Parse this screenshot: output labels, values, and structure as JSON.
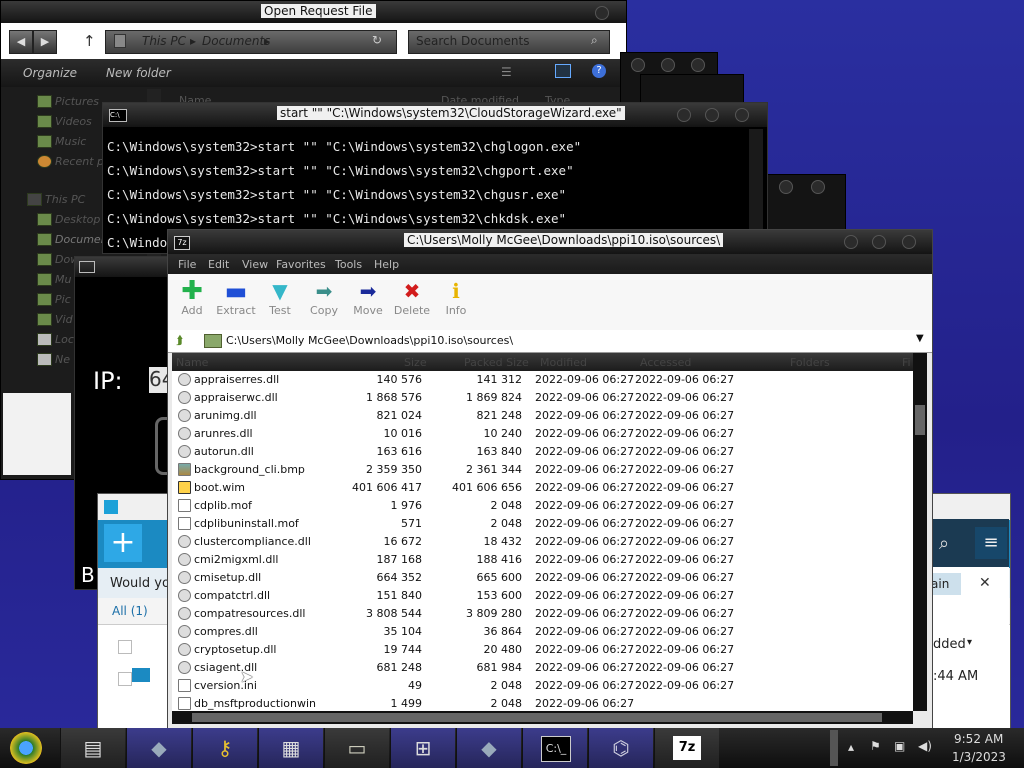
{
  "explorer": {
    "title": "Open Request File",
    "breadcrumb": [
      "This PC",
      "Documents"
    ],
    "search_placeholder": "Search Documents",
    "organize": "Organize",
    "new_folder": "New folder",
    "nav": [
      "Pictures",
      "Videos",
      "Music",
      "Recent pl",
      "This PC",
      "Desktop",
      "Documen",
      "Dow",
      "Mu",
      "Pic",
      "Vid",
      "Loc",
      "Ne"
    ],
    "col_name": "Name",
    "col_date": "Date modified",
    "col_type": "Type"
  },
  "cmd": {
    "title": "start \"\" \"C:\\Windows\\system32\\CloudStorageWizard.exe\"",
    "lines": [
      "C:\\Windows\\system32>start \"\" \"C:\\Windows\\system32\\chglogon.exe\"",
      "C:\\Windows\\system32>start \"\" \"C:\\Windows\\system32\\chgport.exe\"",
      "C:\\Windows\\system32>start \"\" \"C:\\Windows\\system32\\chgusr.exe\"",
      "C:\\Windows\\system32>start \"\" \"C:\\Windows\\system32\\chkdsk.exe\"",
      "C:\\Windo"
    ]
  },
  "ipwin": {
    "label": "IP:",
    "value": "64",
    "b_text": "B"
  },
  "backup": {
    "prompt": "Would yo",
    "tab_all": "All (1)",
    "action": "ain",
    "col_added": "dded",
    "time": ":44 AM"
  },
  "zip": {
    "title": "C:\\Users\\Molly McGee\\Downloads\\ppi10.iso\\sources\\",
    "menu": [
      "File",
      "Edit",
      "View",
      "Favorites",
      "Tools",
      "Help"
    ],
    "tools": [
      {
        "label": "Add",
        "icon": "plus-icon",
        "color": "#22b14c"
      },
      {
        "label": "Extract",
        "icon": "minus-icon",
        "color": "#1f4fd6"
      },
      {
        "label": "Test",
        "icon": "check-icon",
        "color": "#35b7c9"
      },
      {
        "label": "Copy",
        "icon": "arrow-right-icon",
        "color": "#3a8e8a"
      },
      {
        "label": "Move",
        "icon": "arrow-right-icon",
        "color": "#1a2a9a"
      },
      {
        "label": "Delete",
        "icon": "x-icon",
        "color": "#d21c1c"
      },
      {
        "label": "Info",
        "icon": "info-icon",
        "color": "#e8b400"
      }
    ],
    "path": "C:\\Users\\Molly McGee\\Downloads\\ppi10.iso\\sources\\",
    "columns": [
      "Name",
      "Size",
      "Packed Size",
      "Modified",
      "Accessed",
      "Folders",
      "Fi"
    ],
    "files": [
      {
        "name": "appraiserres.dll",
        "size": "140 576",
        "packed": "141 312",
        "modified": "2022-09-06 06:27",
        "accessed": "2022-09-06 06:27",
        "icon": "gear"
      },
      {
        "name": "appraiserwc.dll",
        "size": "1 868 576",
        "packed": "1 869 824",
        "modified": "2022-09-06 06:27",
        "accessed": "2022-09-06 06:27",
        "icon": "gear"
      },
      {
        "name": "arunimg.dll",
        "size": "821 024",
        "packed": "821 248",
        "modified": "2022-09-06 06:27",
        "accessed": "2022-09-06 06:27",
        "icon": "gear"
      },
      {
        "name": "arunres.dll",
        "size": "10 016",
        "packed": "10 240",
        "modified": "2022-09-06 06:27",
        "accessed": "2022-09-06 06:27",
        "icon": "gear"
      },
      {
        "name": "autorun.dll",
        "size": "163 616",
        "packed": "163 840",
        "modified": "2022-09-06 06:27",
        "accessed": "2022-09-06 06:27",
        "icon": "gear"
      },
      {
        "name": "background_cli.bmp",
        "size": "2 359 350",
        "packed": "2 361 344",
        "modified": "2022-09-06 06:27",
        "accessed": "2022-09-06 06:27",
        "icon": "img"
      },
      {
        "name": "boot.wim",
        "size": "401 606 417",
        "packed": "401 606 656",
        "modified": "2022-09-06 06:27",
        "accessed": "2022-09-06 06:27",
        "icon": "wim"
      },
      {
        "name": "cdplib.mof",
        "size": "1 976",
        "packed": "2 048",
        "modified": "2022-09-06 06:27",
        "accessed": "2022-09-06 06:27",
        "icon": "doc"
      },
      {
        "name": "cdplibuninstall.mof",
        "size": "571",
        "packed": "2 048",
        "modified": "2022-09-06 06:27",
        "accessed": "2022-09-06 06:27",
        "icon": "doc"
      },
      {
        "name": "clustercompliance.dll",
        "size": "16 672",
        "packed": "18 432",
        "modified": "2022-09-06 06:27",
        "accessed": "2022-09-06 06:27",
        "icon": "gear"
      },
      {
        "name": "cmi2migxml.dll",
        "size": "187 168",
        "packed": "188 416",
        "modified": "2022-09-06 06:27",
        "accessed": "2022-09-06 06:27",
        "icon": "gear"
      },
      {
        "name": "cmisetup.dll",
        "size": "664 352",
        "packed": "665 600",
        "modified": "2022-09-06 06:27",
        "accessed": "2022-09-06 06:27",
        "icon": "gear"
      },
      {
        "name": "compatctrl.dll",
        "size": "151 840",
        "packed": "153 600",
        "modified": "2022-09-06 06:27",
        "accessed": "2022-09-06 06:27",
        "icon": "gear"
      },
      {
        "name": "compatresources.dll",
        "size": "3 808 544",
        "packed": "3 809 280",
        "modified": "2022-09-06 06:27",
        "accessed": "2022-09-06 06:27",
        "icon": "gear"
      },
      {
        "name": "compres.dll",
        "size": "35 104",
        "packed": "36 864",
        "modified": "2022-09-06 06:27",
        "accessed": "2022-09-06 06:27",
        "icon": "gear"
      },
      {
        "name": "cryptosetup.dll",
        "size": "19 744",
        "packed": "20 480",
        "modified": "2022-09-06 06:27",
        "accessed": "2022-09-06 06:27",
        "icon": "gear"
      },
      {
        "name": "csiagent.dll",
        "size": "681 248",
        "packed": "681 984",
        "modified": "2022-09-06 06:27",
        "accessed": "2022-09-06 06:27",
        "icon": "gear"
      },
      {
        "name": "cversion.ini",
        "size": "49",
        "packed": "2 048",
        "modified": "2022-09-06 06:27",
        "accessed": "2022-09-06 06:27",
        "icon": "doc"
      },
      {
        "name": "db_msftproductionwin",
        "size": "1 499",
        "packed": "2 048",
        "modified": "2022-09-06 06:27",
        "accessed": "",
        "icon": "doc"
      }
    ]
  },
  "taskbar": {
    "time": "9:52 AM",
    "date": "1/3/2023",
    "apps": [
      "chrome-icon",
      "notepad-icon",
      "gem-icon",
      "keys-icon",
      "calculator-icon",
      "drive-icon",
      "installer-icon",
      "gem-icon",
      "cmd-icon",
      "archive-icon",
      "7zip-icon"
    ]
  }
}
